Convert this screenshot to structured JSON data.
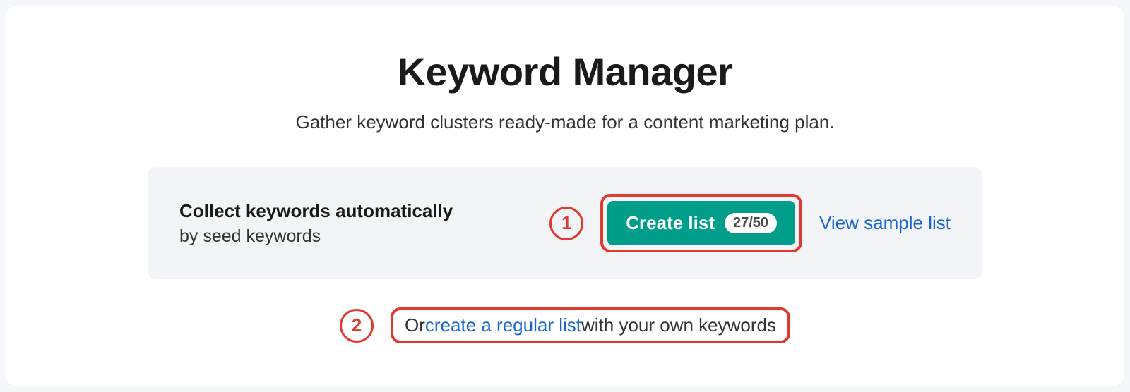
{
  "header": {
    "title": "Keyword Manager",
    "subtitle": "Gather keyword clusters ready-made for a content marketing plan."
  },
  "panel": {
    "heading": "Collect keywords automatically",
    "subheading": "by seed keywords",
    "annotation_1": "1",
    "create_button_label": "Create list",
    "create_button_badge": "27/50",
    "sample_link": "View sample list"
  },
  "bottom": {
    "annotation_2": "2",
    "text_before": "Or ",
    "link_text": "create a regular list",
    "text_after": " with your own keywords"
  }
}
